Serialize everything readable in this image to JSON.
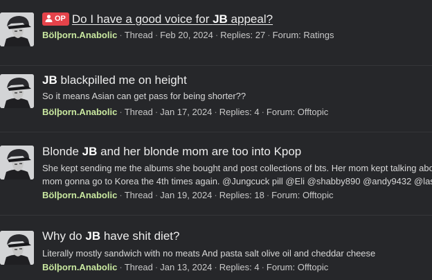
{
  "results": [
    {
      "op_badge": "OP",
      "title_pre": "Do I have a good voice for ",
      "title_hl": "JB",
      "title_post": " appeal?",
      "snippet_lines": [],
      "user": "Bölþorn.Anabolic",
      "kind": "Thread",
      "date": "Feb 20, 2024",
      "replies": "Replies: 27",
      "forum": "Forum: Ratings"
    },
    {
      "op_badge": "",
      "title_pre": "",
      "title_hl": "JB",
      "title_post": " blackpilled me on height",
      "snippet_lines": [
        "So it means Asian can get pass for being shorter??"
      ],
      "user": "Bölþorn.Anabolic",
      "kind": "Thread",
      "date": "Jan 17, 2024",
      "replies": "Replies: 4",
      "forum": "Forum: Offtopic"
    },
    {
      "op_badge": "",
      "title_pre": "Blonde ",
      "title_hl": "JB",
      "title_post": " and her blonde mom are too into Kpop",
      "snippet_lines": [
        "She kept sending me the albums she bought and post collections of bts. Her mom kept talking abo",
        "mom gonna go to Korea the 4th times again. @Jungcuck pill @Eli @shabby890 @andy9432 @lasa"
      ],
      "user": "Bölþorn.Anabolic",
      "kind": "Thread",
      "date": "Jan 19, 2024",
      "replies": "Replies: 18",
      "forum": "Forum: Offtopic"
    },
    {
      "op_badge": "",
      "title_pre": "Why do ",
      "title_hl": "JB",
      "title_post": " have shit diet?",
      "snippet_lines": [
        "Literally mostly sandwich with no meats And pasta salt olive oil and cheddar cheese"
      ],
      "user": "Bölþorn.Anabolic",
      "kind": "Thread",
      "date": "Jan 13, 2024",
      "replies": "Replies: 4",
      "forum": "Forum: Offtopic"
    }
  ],
  "icons": {
    "avatar": "user-avatar-icon",
    "op": "user-icon"
  },
  "colors": {
    "background": "#26272a",
    "username": "#c9e8a0",
    "op_badge": "#e5434a",
    "divider": "#353639"
  }
}
